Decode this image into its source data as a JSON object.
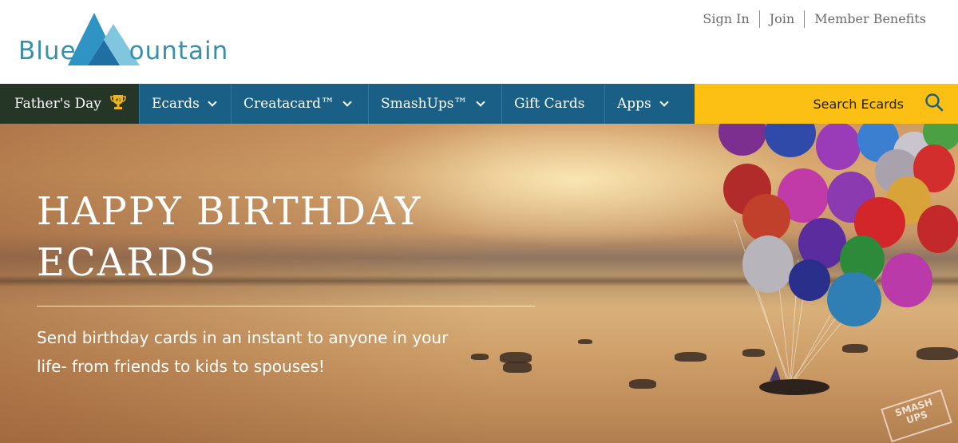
{
  "brand": {
    "logo_first": "Blue",
    "logo_second": "ountain"
  },
  "top_links": {
    "sign_in": "Sign In",
    "join": "Join",
    "member_benefits": "Member Benefits"
  },
  "nav": {
    "featured": "Father's Day",
    "items": [
      {
        "label": "Ecards"
      },
      {
        "label": "Creatacard™"
      },
      {
        "label": "SmashUps™"
      },
      {
        "label": "Gift Cards"
      },
      {
        "label": "Apps"
      }
    ],
    "search_label": "Search Ecards",
    "icons": [
      "trophy-icon",
      "chevron-down-icon",
      "search-icon"
    ]
  },
  "hero": {
    "title_line1": "HAPPY BIRTHDAY",
    "title_line2": "ECARDS",
    "subtitle_line1": "Send birthday cards in an instant to anyone in your",
    "subtitle_line2": "life- from friends to kids to spouses!",
    "watermark_line1": "SMASH",
    "watermark_line2": "UPS"
  },
  "colors": {
    "nav_blue": "#1a5f86",
    "featured_dark": "#253526",
    "search_yellow": "#fbc013",
    "logo_blue": "#3a8fa8"
  }
}
